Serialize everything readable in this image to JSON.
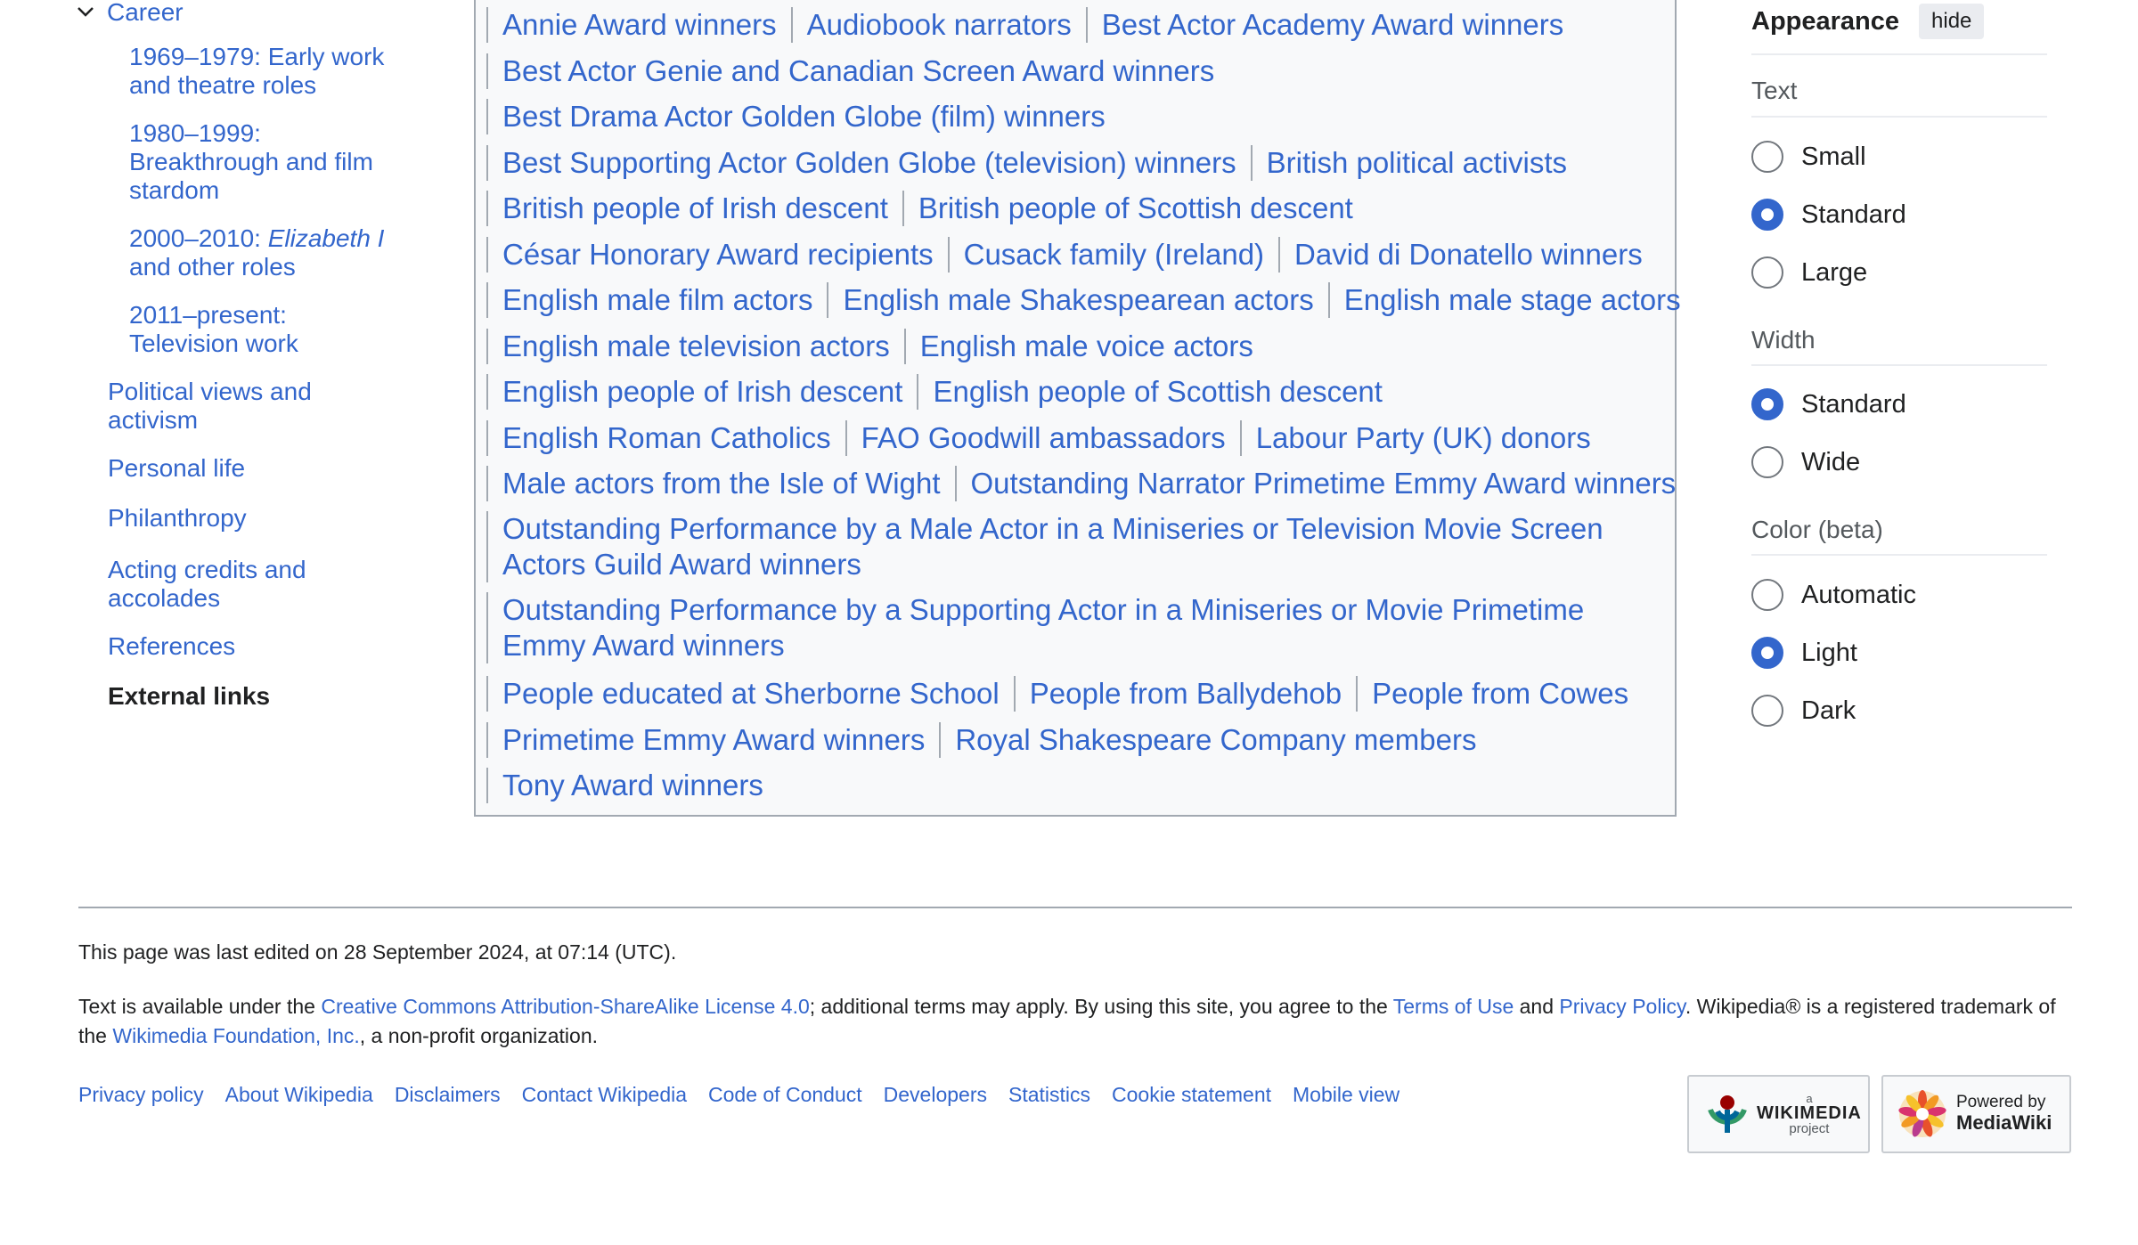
{
  "toc": {
    "career": "Career",
    "sub_1_a": "1969–1979: Early work",
    "sub_1_b": "and theatre roles",
    "sub_2_a": "1980–1999:",
    "sub_2_b": "Breakthrough and film",
    "sub_2_c": "stardom",
    "sub_3_a": "2000–2010: ",
    "sub_3_italic": "Elizabeth I",
    "sub_3_b": "and other roles",
    "sub_4_a": "2011–present:",
    "sub_4_b": "Television work",
    "political_a": "Political views and",
    "political_b": "activism",
    "personal": "Personal life",
    "philanthropy": "Philanthropy",
    "acting_a": "Acting credits and",
    "acting_b": "accolades",
    "references": "References",
    "external": "External links"
  },
  "categories": {
    "rows": [
      [
        "Annie Award winners",
        "Audiobook narrators",
        "Best Actor Academy Award winners"
      ],
      [
        "Best Actor Genie and Canadian Screen Award winners"
      ],
      [
        "Best Drama Actor Golden Globe (film) winners"
      ],
      [
        "Best Supporting Actor Golden Globe (television) winners",
        "British political activists"
      ],
      [
        "British people of Irish descent",
        "British people of Scottish descent"
      ],
      [
        "César Honorary Award recipients",
        "Cusack family (Ireland)",
        "David di Donatello winners"
      ],
      [
        "English male film actors",
        "English male Shakespearean actors",
        "English male stage actors"
      ],
      [
        "English male television actors",
        "English male voice actors"
      ],
      [
        "English people of Irish descent",
        "English people of Scottish descent"
      ],
      [
        "English Roman Catholics",
        "FAO Goodwill ambassadors",
        "Labour Party (UK) donors"
      ],
      [
        "Male actors from the Isle of Wight",
        "Outstanding Narrator Primetime Emmy Award winners"
      ]
    ],
    "wrap_1": "Outstanding Performance by a Male Actor in a Miniseries or Television Movie Screen Actors Guild Award winners",
    "wrap_2": "Outstanding Performance by a Supporting Actor in a Miniseries or Movie Primetime Emmy Award winners",
    "rows_after": [
      [
        "People educated at Sherborne School",
        "People from Ballydehob",
        "People from Cowes"
      ],
      [
        "Primetime Emmy Award winners",
        "Royal Shakespeare Company members"
      ],
      [
        "Tony Award winners"
      ]
    ]
  },
  "appearance": {
    "title": "Appearance",
    "hide": "hide",
    "text_label": "Text",
    "text_small": "Small",
    "text_standard": "Standard",
    "text_large": "Large",
    "width_label": "Width",
    "width_standard": "Standard",
    "width_wide": "Wide",
    "color_label": "Color (beta)",
    "color_auto": "Automatic",
    "color_light": "Light",
    "color_dark": "Dark"
  },
  "footer": {
    "last_edited": "This page was last edited on 28 September 2024, at 07:14 (UTC).",
    "lic_1": "Text is available under the ",
    "lic_link_cc": "Creative Commons Attribution-ShareAlike License 4.0",
    "lic_2": "; additional terms may apply. By using this site, you agree to the ",
    "lic_link_terms": "Terms of Use",
    "lic_3": " and ",
    "lic_link_privacy": "Privacy Policy",
    "lic_4": ". Wikipedia® is a registered trademark of the ",
    "lic_link_wmf": "Wikimedia Foundation, Inc.",
    "lic_5": ", a non-profit organization.",
    "links": [
      "Privacy policy",
      "About Wikipedia",
      "Disclaimers",
      "Contact Wikipedia",
      "Code of Conduct",
      "Developers",
      "Statistics",
      "Cookie statement",
      "Mobile view"
    ],
    "wm_small": "a",
    "wm_name": "WIKIMEDIA",
    "wm_sub": "project",
    "mw_line1": "Powered by",
    "mw_line2": "MediaWiki"
  },
  "colors": {
    "link": "#3366cc",
    "text": "#202122",
    "border": "#a2a9b1",
    "radio_on": "#3366cc"
  }
}
